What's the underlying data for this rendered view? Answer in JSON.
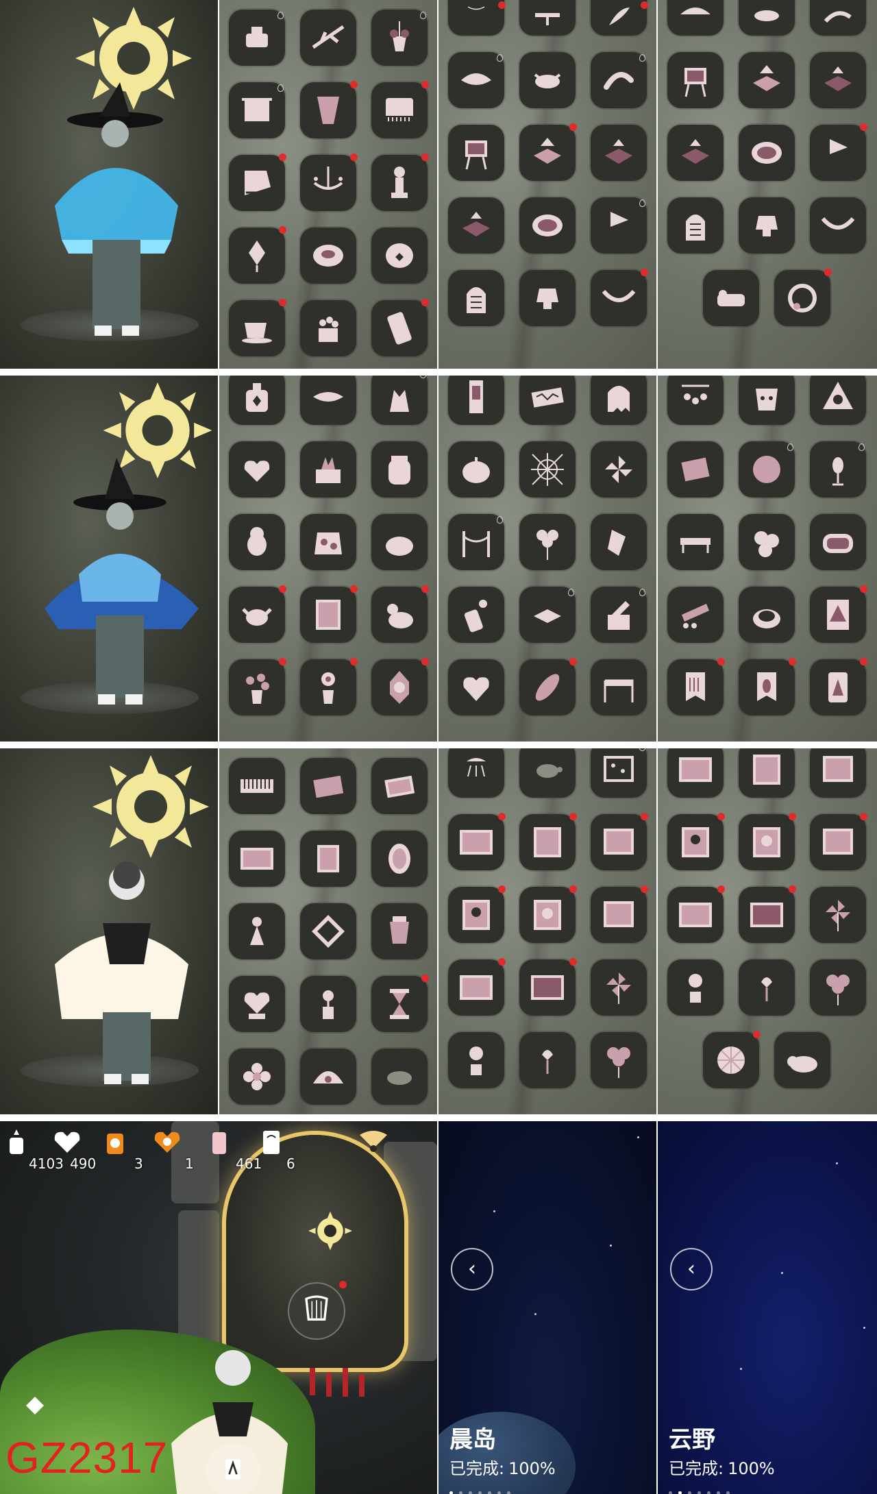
{
  "hud": {
    "candles": "4103",
    "hearts": "490",
    "season_candles": "3",
    "season_hearts": "1",
    "ascended": "461",
    "tickets": "6"
  },
  "watermark": "GZ2317",
  "maps": [
    {
      "name": "晨岛",
      "status_label": "已完成:",
      "status_value": "100%",
      "back": "‹"
    },
    {
      "name": "云野",
      "status_label": "已完成:",
      "status_value": "100%",
      "back": "‹"
    }
  ],
  "colors": {
    "accent_red": "#e02b2b",
    "slot_bg": "#2f302c",
    "icon": "#e9d6d8",
    "icon_dark": "#8a5a6a",
    "sun": "#f3e79a"
  }
}
